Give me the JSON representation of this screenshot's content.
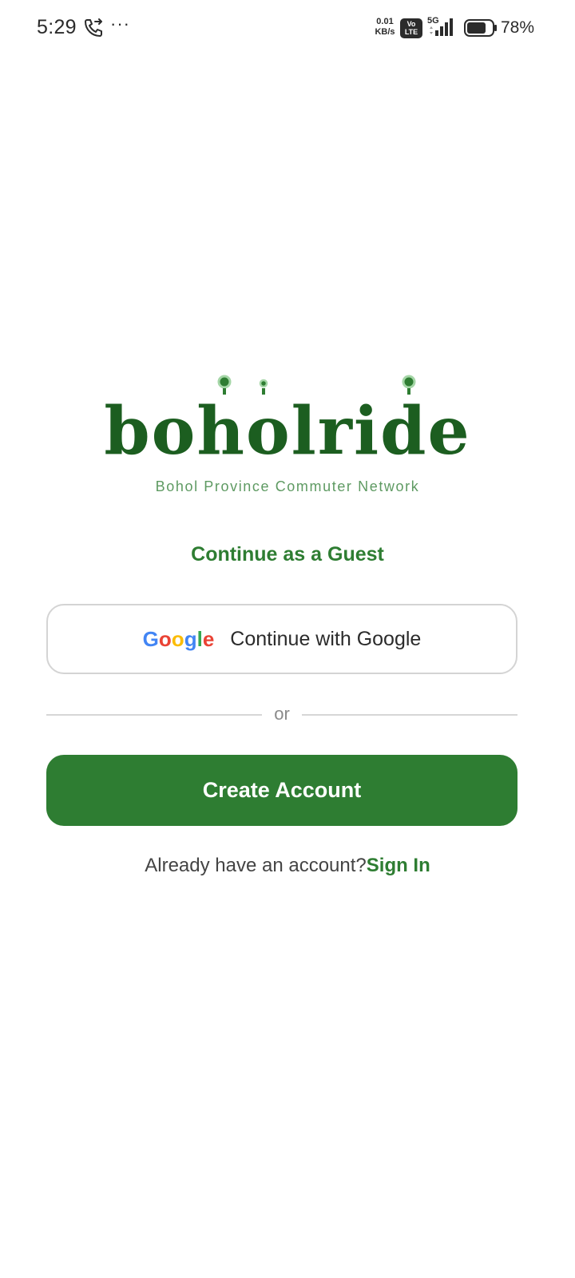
{
  "status_bar": {
    "time": "5:29",
    "more": "···",
    "speed_value": "0.01",
    "speed_unit": "KB/s",
    "volte_top": "Vo",
    "volte_bottom": "LTE",
    "network": "5G",
    "battery_percent": "78%",
    "battery_level": 0.78
  },
  "logo": {
    "wordmark": "boholride",
    "tagline": "Bohol Province Commuter Network",
    "color": "#1c5e20"
  },
  "guest_link": "Continue as a Guest",
  "google_button": {
    "logo_letters": [
      "G",
      "o",
      "o",
      "g",
      "l",
      "e"
    ],
    "label": "Continue with Google"
  },
  "divider_text": "or",
  "create_account_button": "Create Account",
  "signin_prompt": {
    "text": "Already have an account?",
    "link": "Sign In"
  },
  "colors": {
    "primary": "#2e7d32",
    "tagline": "#5e9a62"
  }
}
